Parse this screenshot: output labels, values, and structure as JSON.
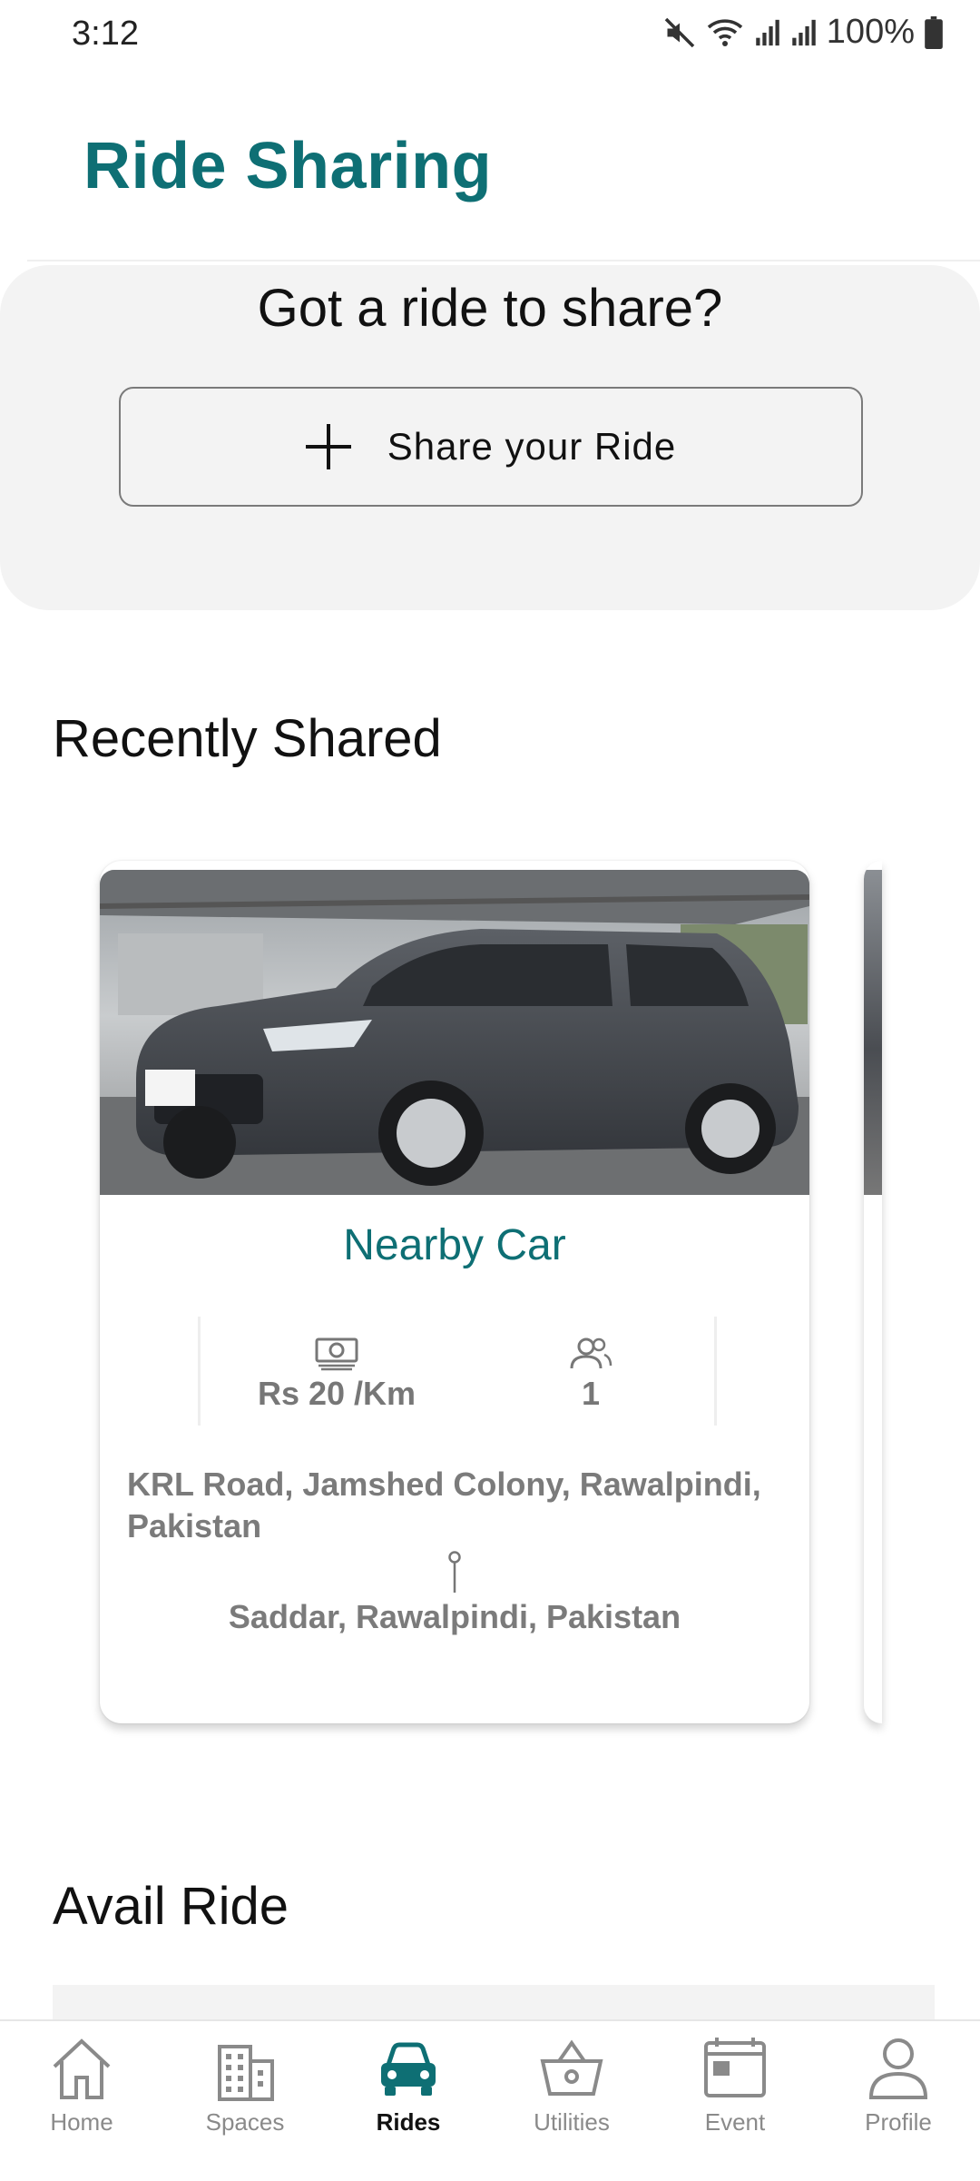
{
  "status_bar": {
    "time": "3:12",
    "battery": "100%",
    "icons": [
      "mute-icon",
      "wifi-icon",
      "signal-icon",
      "signal-icon",
      "battery-icon"
    ]
  },
  "header": {
    "title": "Ride Sharing"
  },
  "share": {
    "heading": "Got a ride to share?",
    "button_label": "Share your Ride"
  },
  "recent": {
    "title": "Recently Shared",
    "cards": [
      {
        "title": "Nearby Car",
        "price": "Rs 20 /Km",
        "seats": "1",
        "pickup": "KRL Road, Jamshed Colony, Rawalpindi, Pakistan",
        "dropoff": "Saddar, Rawalpindi, Pakistan"
      }
    ]
  },
  "avail": {
    "title": "Avail Ride"
  },
  "nav": {
    "active": "Rides",
    "items": [
      {
        "label": "Home",
        "icon": "home-icon"
      },
      {
        "label": "Spaces",
        "icon": "building-icon"
      },
      {
        "label": "Rides",
        "icon": "car-icon"
      },
      {
        "label": "Utilities",
        "icon": "basket-icon"
      },
      {
        "label": "Event",
        "icon": "calendar-icon"
      },
      {
        "label": "Profile",
        "icon": "person-icon"
      }
    ]
  },
  "colors": {
    "brand": "#0e6f74",
    "muted_text": "#7b7b7b",
    "panel_bg": "#f3f3f3"
  }
}
